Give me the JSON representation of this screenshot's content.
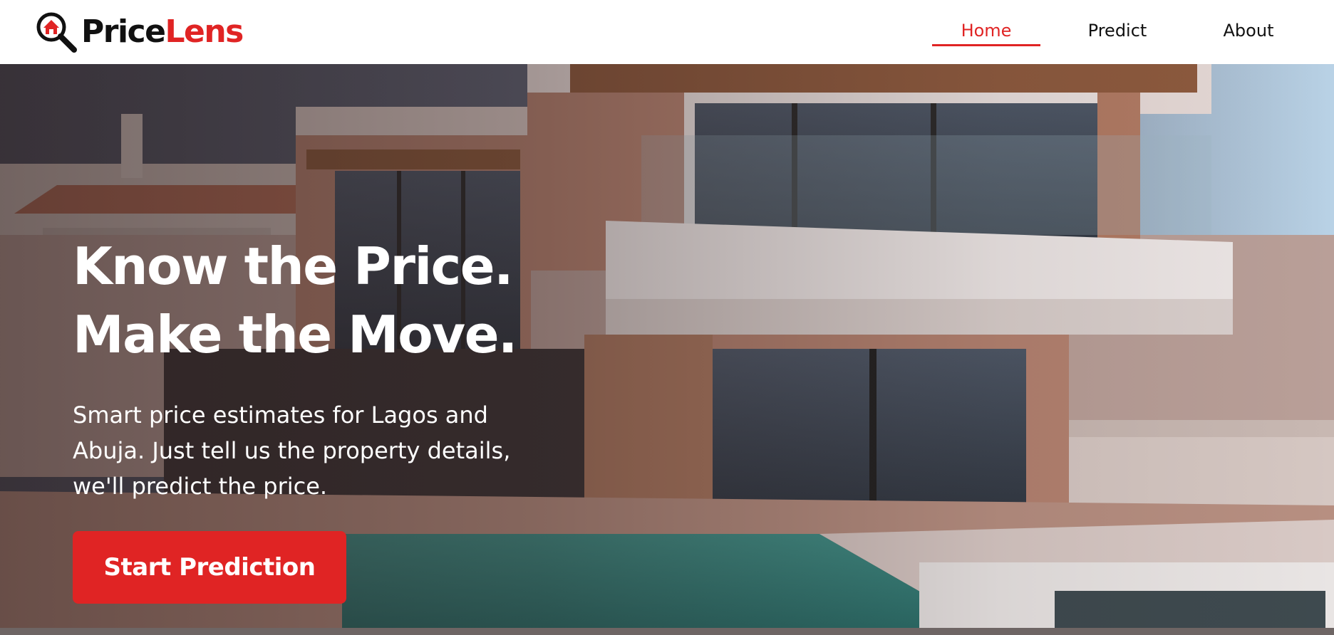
{
  "brand": {
    "name_part1": "Price",
    "name_part2": "Lens",
    "icon": "magnifier-house-icon",
    "accent_color": "#e02424"
  },
  "nav": {
    "items": [
      {
        "label": "Home",
        "active": true
      },
      {
        "label": "Predict",
        "active": false
      },
      {
        "label": "About",
        "active": false
      }
    ]
  },
  "hero": {
    "headline_line1": "Know the Price.",
    "headline_line2": "Make the Move.",
    "subtext_line1": "Smart price estimates for Lagos and",
    "subtext_line2": "Abuja. Just tell us the property details,",
    "subtext_line3": "we'll predict the price.",
    "cta_label": "Start Prediction",
    "background": "modern-house-with-pool-photo"
  }
}
